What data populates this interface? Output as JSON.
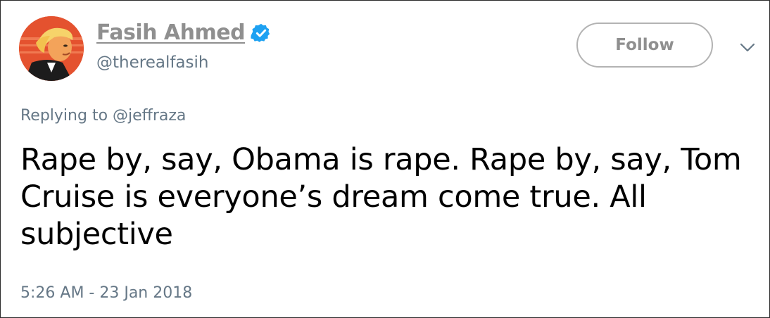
{
  "author": {
    "display_name": "Fasih Ahmed",
    "handle": "@therealfasih",
    "verified": true,
    "avatar": "avatar-cartoon-portrait"
  },
  "follow_button": {
    "label": "Follow"
  },
  "menu_icon": "chevron-down-icon",
  "reply": {
    "prefix": "Replying to ",
    "to_handle": "@jeffraza"
  },
  "tweet": {
    "text": "Rape by, say, Obama is rape. Rape by, say, Tom Cruise is everyone’s dream come true. All subjective",
    "timestamp": "5:26 AM - 23 Jan 2018"
  },
  "colors": {
    "verified_badge": "#1da1f2",
    "avatar_background": "#e4522f",
    "muted_text": "#657786",
    "button_text": "#8f8f8f"
  }
}
